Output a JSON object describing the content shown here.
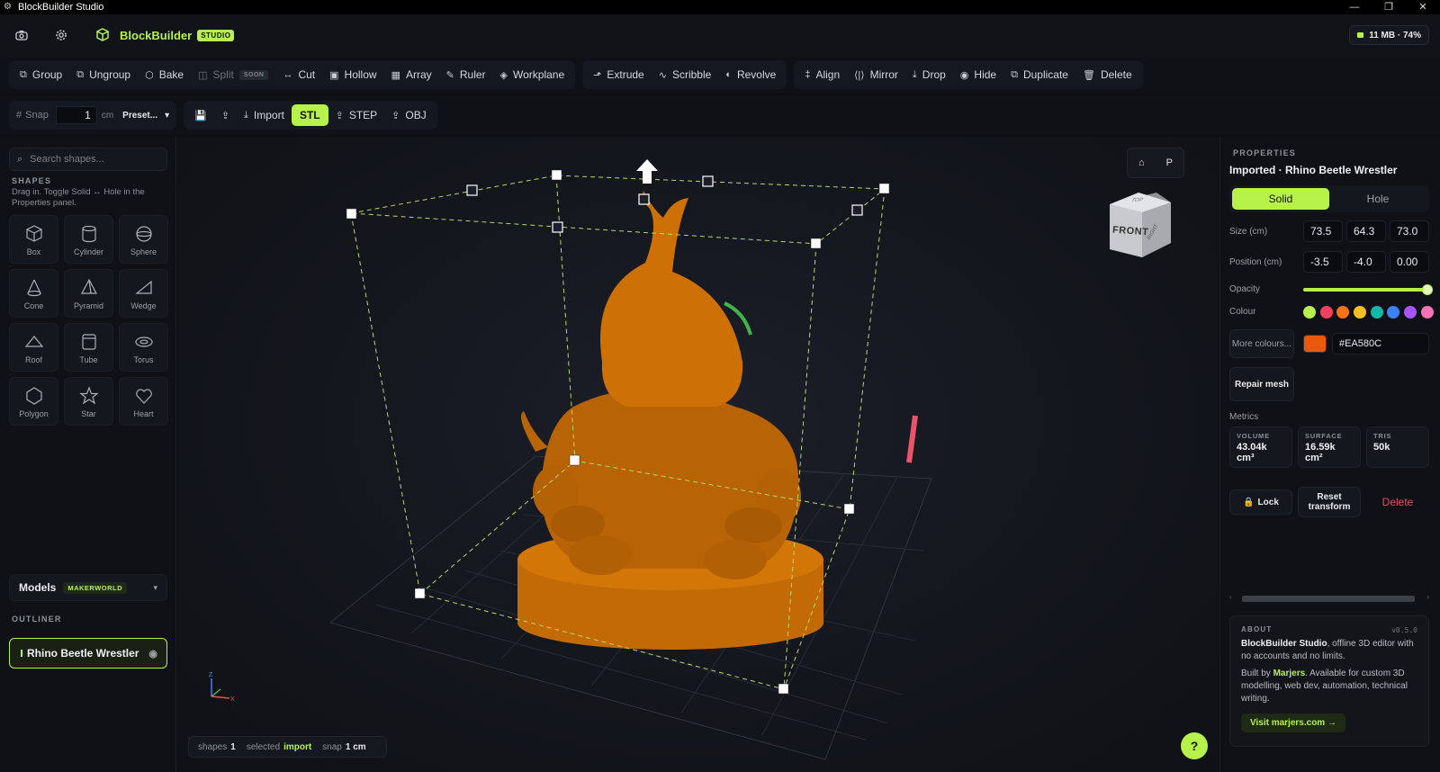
{
  "window": {
    "title": "BlockBuilder Studio",
    "controls": [
      "—",
      "❐",
      "✕"
    ]
  },
  "app": {
    "brand": "BlockBuilder",
    "badge": "STUDIO",
    "memory": "11 MB · 74%"
  },
  "toolbar": {
    "group": "Group",
    "ungroup": "Ungroup",
    "bake": "Bake",
    "split": "Split",
    "soon": "SOON",
    "cut": "Cut",
    "hollow": "Hollow",
    "array": "Array",
    "ruler": "Ruler",
    "workplane": "Workplane",
    "extrude": "Extrude",
    "scribble": "Scribble",
    "revolve": "Revolve",
    "align": "Align",
    "mirror": "Mirror",
    "drop": "Drop",
    "hide": "Hide",
    "duplicate": "Duplicate",
    "delete": "Delete"
  },
  "toolbar2": {
    "snap_label": "Snap",
    "snap_value": "1",
    "unit": "cm",
    "preset": "Preset...",
    "import": "Import",
    "stl": "STL",
    "step": "STEP",
    "obj": "OBJ"
  },
  "sidebar": {
    "search_placeholder": "Search shapes...",
    "shapes_label": "SHAPES",
    "hint": "Drag in. Toggle Solid ↔ Hole in the Properties panel.",
    "shapes": [
      "Box",
      "Cylinder",
      "Sphere",
      "Cone",
      "Pyramid",
      "Wedge",
      "Roof",
      "Tube",
      "Torus",
      "Polygon",
      "Star",
      "Heart"
    ],
    "models_label": "Models",
    "models_badge": "MAKERWORLD",
    "outliner_label": "OUTLINER",
    "outliner_item": "Rhino Beetle Wrestler"
  },
  "viewport": {
    "home": "⌂",
    "persp": "P",
    "cube_front": "FRONT",
    "cube_top": "TOP",
    "cube_right": "RIGHT",
    "status": {
      "shapes_label": "shapes",
      "shapes_value": "1",
      "selected_label": "selected",
      "selected_value": "import",
      "snap_label": "snap",
      "snap_value": "1 cm"
    },
    "help": "?",
    "model_color": "#C26A06"
  },
  "properties": {
    "section": "PROPERTIES",
    "title": "Imported · Rhino Beetle Wrestler",
    "solid": "Solid",
    "hole": "Hole",
    "size_label": "Size (cm)",
    "size": [
      "73.5",
      "64.3",
      "73.0"
    ],
    "position_label": "Position (cm)",
    "position": [
      "-3.5",
      "-4.0",
      "0.00"
    ],
    "opacity_label": "Opacity",
    "opacity": 1.0,
    "colour_label": "Colour",
    "swatches": [
      "#b6f24a",
      "#f43f5e",
      "#f97316",
      "#fbbf24",
      "#14b8a6",
      "#3b82f6",
      "#a855f7",
      "#f472b6"
    ],
    "more_colours": "More colours...",
    "current_colour": "#EA580C",
    "repair": "Repair mesh",
    "metrics_label": "Metrics",
    "volume_label": "VOLUME",
    "volume": "43.04k cm³",
    "surface_label": "SURFACE",
    "surface": "16.59k cm²",
    "tris_label": "TRIS",
    "tris": "50k",
    "lock": "Lock",
    "reset": "Reset transform",
    "delete": "Delete",
    "about_label": "ABOUT",
    "version": "v0.5.0",
    "about_name": "BlockBuilder Studio",
    "about_text": ", offline 3D editor with no accounts and no limits.",
    "built_by": "Built by ",
    "author": "Marjers",
    "built_text": ". Available for custom 3D modelling, web dev, automation, technical writing.",
    "visit": "Visit marjers.com →"
  }
}
